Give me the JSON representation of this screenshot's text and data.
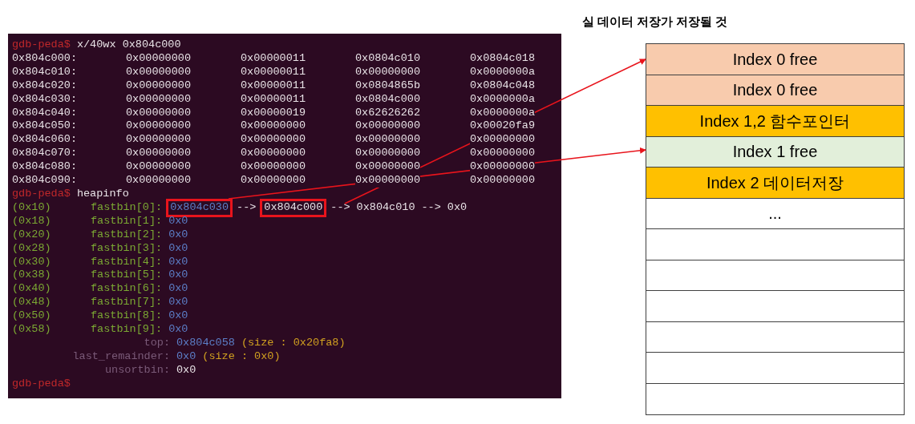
{
  "terminal": {
    "command": {
      "prompt": "gdb-peda$",
      "text": "x/40wx 0x804c000"
    },
    "dump": [
      {
        "address": "0x804c000:",
        "words": [
          "0x00000000",
          "0x00000011",
          "0x0804c010",
          "0x0804c018"
        ]
      },
      {
        "address": "0x804c010:",
        "words": [
          "0x00000000",
          "0x00000011",
          "0x00000000",
          "0x0000000a"
        ]
      },
      {
        "address": "0x804c020:",
        "words": [
          "0x00000000",
          "0x00000011",
          "0x0804865b",
          "0x0804c048"
        ]
      },
      {
        "address": "0x804c030:",
        "words": [
          "0x00000000",
          "0x00000011",
          "0x0804c000",
          "0x0000000a"
        ]
      },
      {
        "address": "0x804c040:",
        "words": [
          "0x00000000",
          "0x00000019",
          "0x62626262",
          "0x0000000a"
        ]
      },
      {
        "address": "0x804c050:",
        "words": [
          "0x00000000",
          "0x00000000",
          "0x00000000",
          "0x00020fa9"
        ]
      },
      {
        "address": "0x804c060:",
        "words": [
          "0x00000000",
          "0x00000000",
          "0x00000000",
          "0x00000000"
        ]
      },
      {
        "address": "0x804c070:",
        "words": [
          "0x00000000",
          "0x00000000",
          "0x00000000",
          "0x00000000"
        ]
      },
      {
        "address": "0x804c080:",
        "words": [
          "0x00000000",
          "0x00000000",
          "0x00000000",
          "0x00000000"
        ]
      },
      {
        "address": "0x804c090:",
        "words": [
          "0x00000000",
          "0x00000000",
          "0x00000000",
          "0x00000000"
        ]
      }
    ],
    "command2": {
      "prompt": "gdb-peda$",
      "text": "heapinfo"
    },
    "fastbins": [
      {
        "size": "(0x10)",
        "name": "fastbin[0]:",
        "chain": [
          {
            "kind": "value",
            "text": "0x804c030",
            "highlighted": true
          },
          {
            "kind": "arrow",
            "text": "-->"
          },
          {
            "kind": "plain",
            "text": "0x804c000",
            "highlighted": true
          },
          {
            "kind": "arrow",
            "text": "-->"
          },
          {
            "kind": "plain",
            "text": "0x804c010"
          },
          {
            "kind": "arrow",
            "text": "-->"
          },
          {
            "kind": "plain",
            "text": "0x0"
          }
        ]
      },
      {
        "size": "(0x18)",
        "name": "fastbin[1]:",
        "chain": [
          {
            "kind": "value",
            "text": "0x0"
          }
        ]
      },
      {
        "size": "(0x20)",
        "name": "fastbin[2]:",
        "chain": [
          {
            "kind": "value",
            "text": "0x0"
          }
        ]
      },
      {
        "size": "(0x28)",
        "name": "fastbin[3]:",
        "chain": [
          {
            "kind": "value",
            "text": "0x0"
          }
        ]
      },
      {
        "size": "(0x30)",
        "name": "fastbin[4]:",
        "chain": [
          {
            "kind": "value",
            "text": "0x0"
          }
        ]
      },
      {
        "size": "(0x38)",
        "name": "fastbin[5]:",
        "chain": [
          {
            "kind": "value",
            "text": "0x0"
          }
        ]
      },
      {
        "size": "(0x40)",
        "name": "fastbin[6]:",
        "chain": [
          {
            "kind": "value",
            "text": "0x0"
          }
        ]
      },
      {
        "size": "(0x48)",
        "name": "fastbin[7]:",
        "chain": [
          {
            "kind": "value",
            "text": "0x0"
          }
        ]
      },
      {
        "size": "(0x50)",
        "name": "fastbin[8]:",
        "chain": [
          {
            "kind": "value",
            "text": "0x0"
          }
        ]
      },
      {
        "size": "(0x58)",
        "name": "fastbin[9]:",
        "chain": [
          {
            "kind": "value",
            "text": "0x0"
          }
        ]
      }
    ],
    "summary": [
      {
        "name": "top:",
        "chain": [
          {
            "kind": "value",
            "text": "0x804c058"
          },
          {
            "kind": "size",
            "text": "(size : 0x20fa8)"
          }
        ]
      },
      {
        "name": "last_remainder:",
        "chain": [
          {
            "kind": "value",
            "text": "0x0"
          },
          {
            "kind": "size",
            "text": "(size : 0x0)"
          }
        ]
      },
      {
        "name": "unsortbin:",
        "chain": [
          {
            "kind": "plain",
            "text": "0x0"
          }
        ]
      }
    ],
    "final_prompt": "gdb-peda$"
  },
  "diagram": {
    "title": "실 데이터 저장가 저장될 것",
    "rows": [
      {
        "kind": "label",
        "text": "Index 0 free",
        "color": "#f8cbad"
      },
      {
        "kind": "label",
        "text": "Index 0 free",
        "color": "#f8cbad"
      },
      {
        "kind": "label",
        "text": "Index 1,2 함수포인터",
        "color": "#ffc000"
      },
      {
        "kind": "label",
        "text": "Index 1 free",
        "color": "#e2efda"
      },
      {
        "kind": "label",
        "text": "Index 2 데이터저장",
        "color": "#ffc000"
      },
      {
        "kind": "label",
        "text": "...",
        "color": "#ffffff"
      },
      {
        "kind": "empty"
      },
      {
        "kind": "empty"
      },
      {
        "kind": "empty"
      },
      {
        "kind": "empty"
      },
      {
        "kind": "empty"
      },
      {
        "kind": "empty"
      }
    ]
  }
}
